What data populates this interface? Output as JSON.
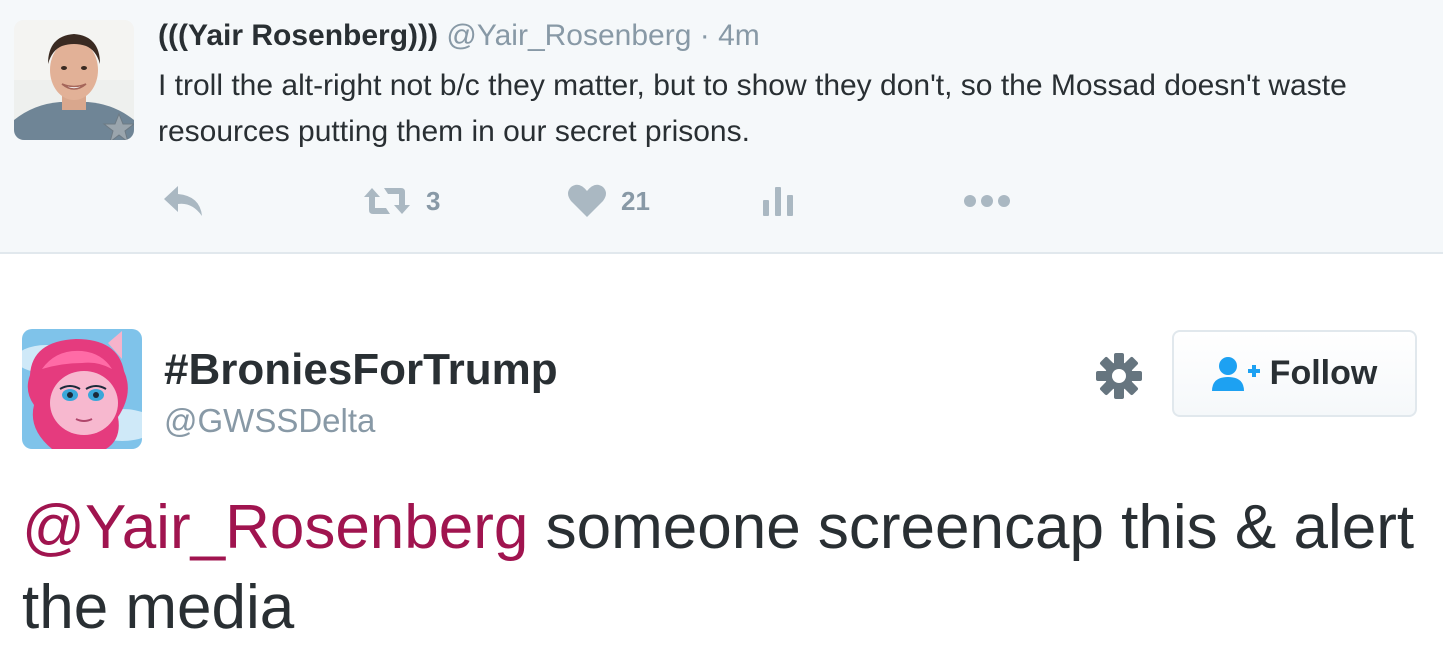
{
  "quoted_tweet": {
    "fullname": "(((Yair Rosenberg)))",
    "username": "@Yair_Rosenberg",
    "separator": "·",
    "time": "4m",
    "text": "I troll the alt-right not b/c they matter, but to show they don't, so the Mossad doesn't waste resources putting them in our secret prisons.",
    "retweet_count": "3",
    "like_count": "21",
    "icons": [
      "reply-icon",
      "retweet-icon",
      "heart-icon",
      "analytics-icon",
      "more-icon",
      "verified-badge-icon"
    ]
  },
  "reply_tweet": {
    "fullname": "#BroniesForTrump",
    "username": "@GWSSDelta",
    "follow_label": "Follow",
    "mention": "@Yair_Rosenberg",
    "text": " someone screencap this & alert the media",
    "icons": [
      "gear-icon",
      "follow-user-icon"
    ]
  },
  "colors": {
    "mention": "#a0144f",
    "follow_icon": "#1da1f2",
    "muted": "#8899a6",
    "text": "#292f33",
    "top_bg": "#f5f8fa"
  }
}
